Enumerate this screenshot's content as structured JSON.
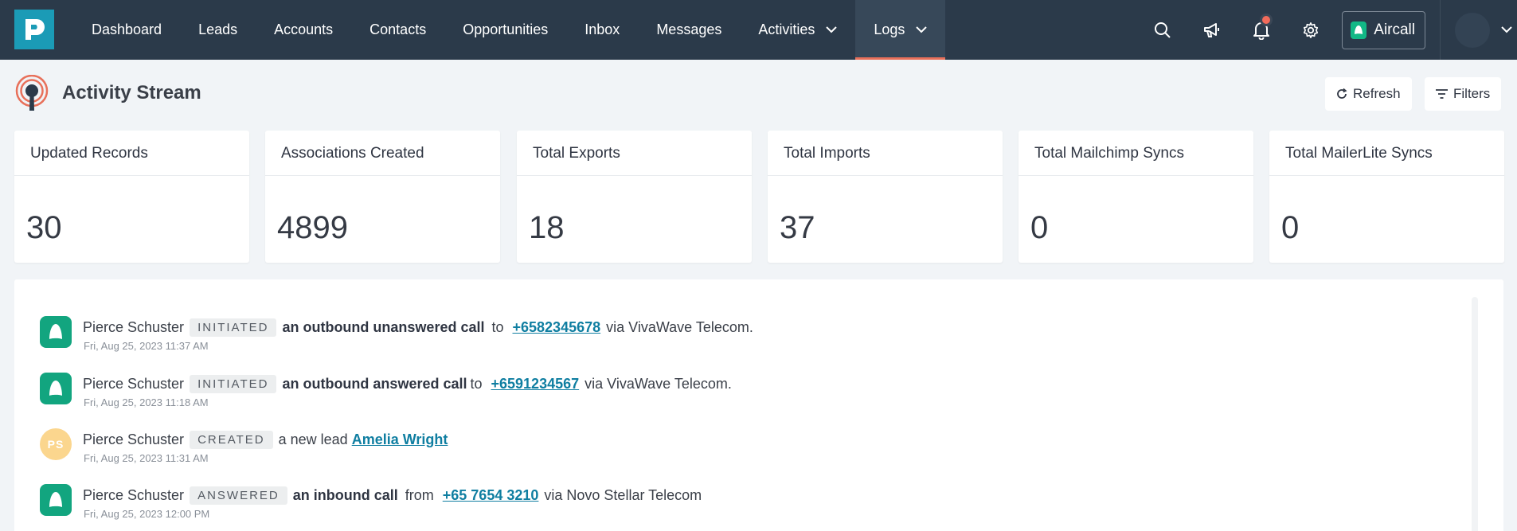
{
  "nav": {
    "items": [
      {
        "label": "Dashboard"
      },
      {
        "label": "Leads"
      },
      {
        "label": "Accounts"
      },
      {
        "label": "Contacts"
      },
      {
        "label": "Opportunities"
      },
      {
        "label": "Inbox"
      },
      {
        "label": "Messages"
      },
      {
        "label": "Activities"
      },
      {
        "label": "Logs"
      }
    ],
    "aircall_label": "Aircall",
    "accent_color": "#e8705a"
  },
  "header": {
    "title": "Activity Stream",
    "refresh_label": "Refresh",
    "filters_label": "Filters"
  },
  "stats": [
    {
      "label": "Updated Records",
      "value": "30"
    },
    {
      "label": "Associations Created",
      "value": "4899"
    },
    {
      "label": "Total Exports",
      "value": "18"
    },
    {
      "label": "Total Imports",
      "value": "37"
    },
    {
      "label": "Total Mailchimp Syncs",
      "value": "0"
    },
    {
      "label": "Total MailerLite Syncs",
      "value": "0"
    }
  ],
  "stream": [
    {
      "user": "Pierce Schuster",
      "badge": "INITIATED",
      "action": "an outbound unanswered call",
      "pre": "to",
      "link": "+6582345678",
      "post": "via VivaWave Telecom.",
      "time": "Fri, Aug 25, 2023 11:37 AM"
    },
    {
      "user": "Pierce Schuster",
      "badge": "INITIATED",
      "action": "an outbound answered call",
      "pre": "to",
      "link": "+6591234567",
      "post": "via VivaWave Telecom.",
      "time": "Fri, Aug 25, 2023 11:18 AM"
    },
    {
      "user": "Pierce Schuster",
      "badge": "CREATED",
      "action": "a new lead",
      "link": "Amelia Wright",
      "time": "Fri, Aug 25, 2023 11:31 AM",
      "initials": "PS"
    },
    {
      "user": "Pierce Schuster",
      "badge": "ANSWERED",
      "action": "an inbound call",
      "pre": "from",
      "link": "+65 7654 3210",
      "post": "via Novo Stellar Telecom",
      "time": "Fri, Aug 25, 2023 12:00 PM"
    }
  ]
}
